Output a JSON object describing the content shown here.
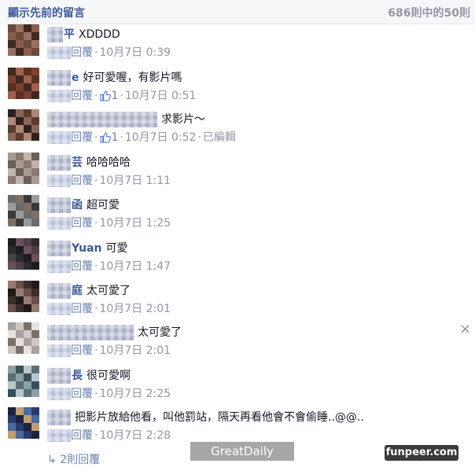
{
  "header": {
    "show_previous": "顯示先前的留言",
    "count": "686則中的50則"
  },
  "reply_label": "回覆",
  "edited_label": "已編輯",
  "comments": [
    {
      "name_tail": "平",
      "text": "XDDDD",
      "likes": null,
      "time": "10月7日 0:39",
      "edited": false,
      "name_blur": 2
    },
    {
      "name_tail": "e",
      "text": "好可愛喔，有影片嗎",
      "likes": "1",
      "time": "10月7日 0:51",
      "edited": false,
      "name_blur": 3
    },
    {
      "name_tail": "",
      "text": "求影片～",
      "likes": "1",
      "time": "10月7日 0:52",
      "edited": true,
      "name_blur": 14
    },
    {
      "name_tail": "芸",
      "text": "哈哈哈哈",
      "likes": null,
      "time": "10月7日 1:11",
      "edited": false,
      "name_blur": 3
    },
    {
      "name_tail": "函",
      "text": "超可愛",
      "likes": null,
      "time": "10月7日 1:25",
      "edited": false,
      "name_blur": 3
    },
    {
      "name_tail": "Yuan",
      "text": "可愛",
      "likes": null,
      "time": "10月7日 1:47",
      "edited": false,
      "name_blur": 3
    },
    {
      "name_tail": "庭",
      "text": "太可愛了",
      "likes": null,
      "time": "10月7日 2:01",
      "edited": false,
      "name_blur": 3
    },
    {
      "name_tail": "",
      "text": "太可愛了",
      "likes": null,
      "time": "10月7日 2:01",
      "edited": false,
      "name_blur": 11
    },
    {
      "name_tail": "長",
      "text": "很可愛啊",
      "likes": null,
      "time": "10月7日 2:25",
      "edited": false,
      "name_blur": 3
    },
    {
      "name_tail": "",
      "text": "把影片放給他看，叫他罰站，隔天再看他會不會偷睡..@@..",
      "likes": null,
      "time": "10月7日 2:28",
      "edited": false,
      "name_blur": 3
    }
  ],
  "more_replies": "2則回覆",
  "watermarks": {
    "left": "GreatDaily",
    "right": "funpeer.com"
  },
  "colors": {
    "link": "#3b5998",
    "meta": "#9197a3",
    "reply": "#6d84b4",
    "header_bg": "#f6f7f9"
  }
}
